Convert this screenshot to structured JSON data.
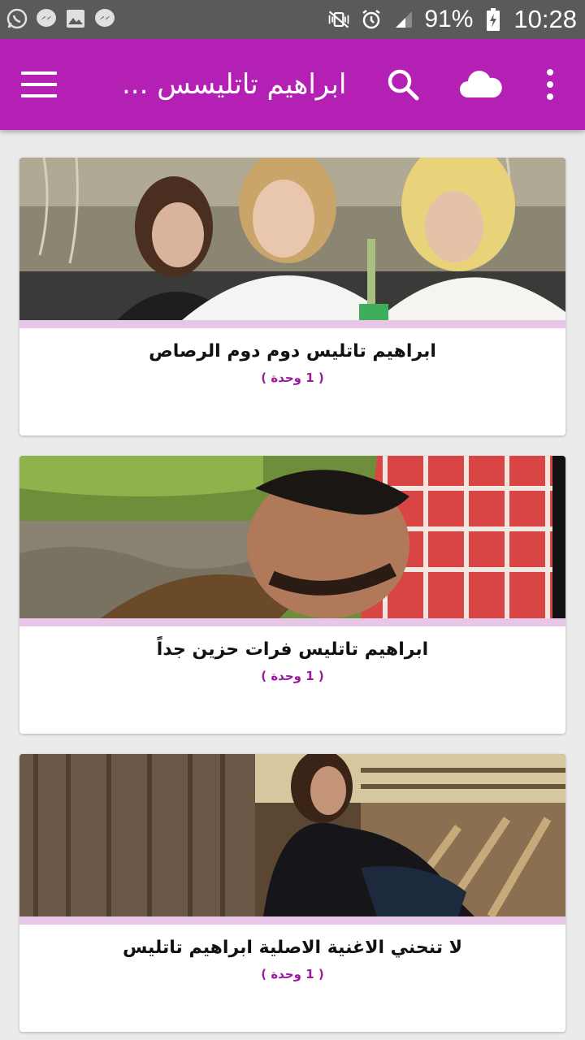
{
  "status_bar": {
    "battery_text": "91%",
    "time": "10:28",
    "icons_left": [
      "whatsapp-icon",
      "messenger-icon",
      "image-icon",
      "messenger-icon"
    ],
    "icons_right": [
      "mute-vibrate-icon",
      "alarm-icon",
      "signal-icon",
      "battery-charging-icon"
    ]
  },
  "app_bar": {
    "title": "ابراهيم تاتليسس ...",
    "background_color": "#b320b3",
    "icons": [
      "menu-icon",
      "search-icon",
      "cloud-icon",
      "more-vert-icon"
    ]
  },
  "cards": [
    {
      "title": "ابراهيم تاتليس دوم دوم الرصاص",
      "count": "( 1 وحدة )"
    },
    {
      "title": "ابراهيم تاتليس فرات حزين جداً",
      "count": "( 1 وحدة )"
    },
    {
      "title": "لا تنحني الاغنية الاصلية ابراهيم تاتليس",
      "count": "( 1 وحدة )"
    }
  ],
  "colors": {
    "accent": "#b320b3",
    "stripe": "#e8c6e8",
    "count_text": "#9c1b9c",
    "background": "#ebebeb"
  }
}
